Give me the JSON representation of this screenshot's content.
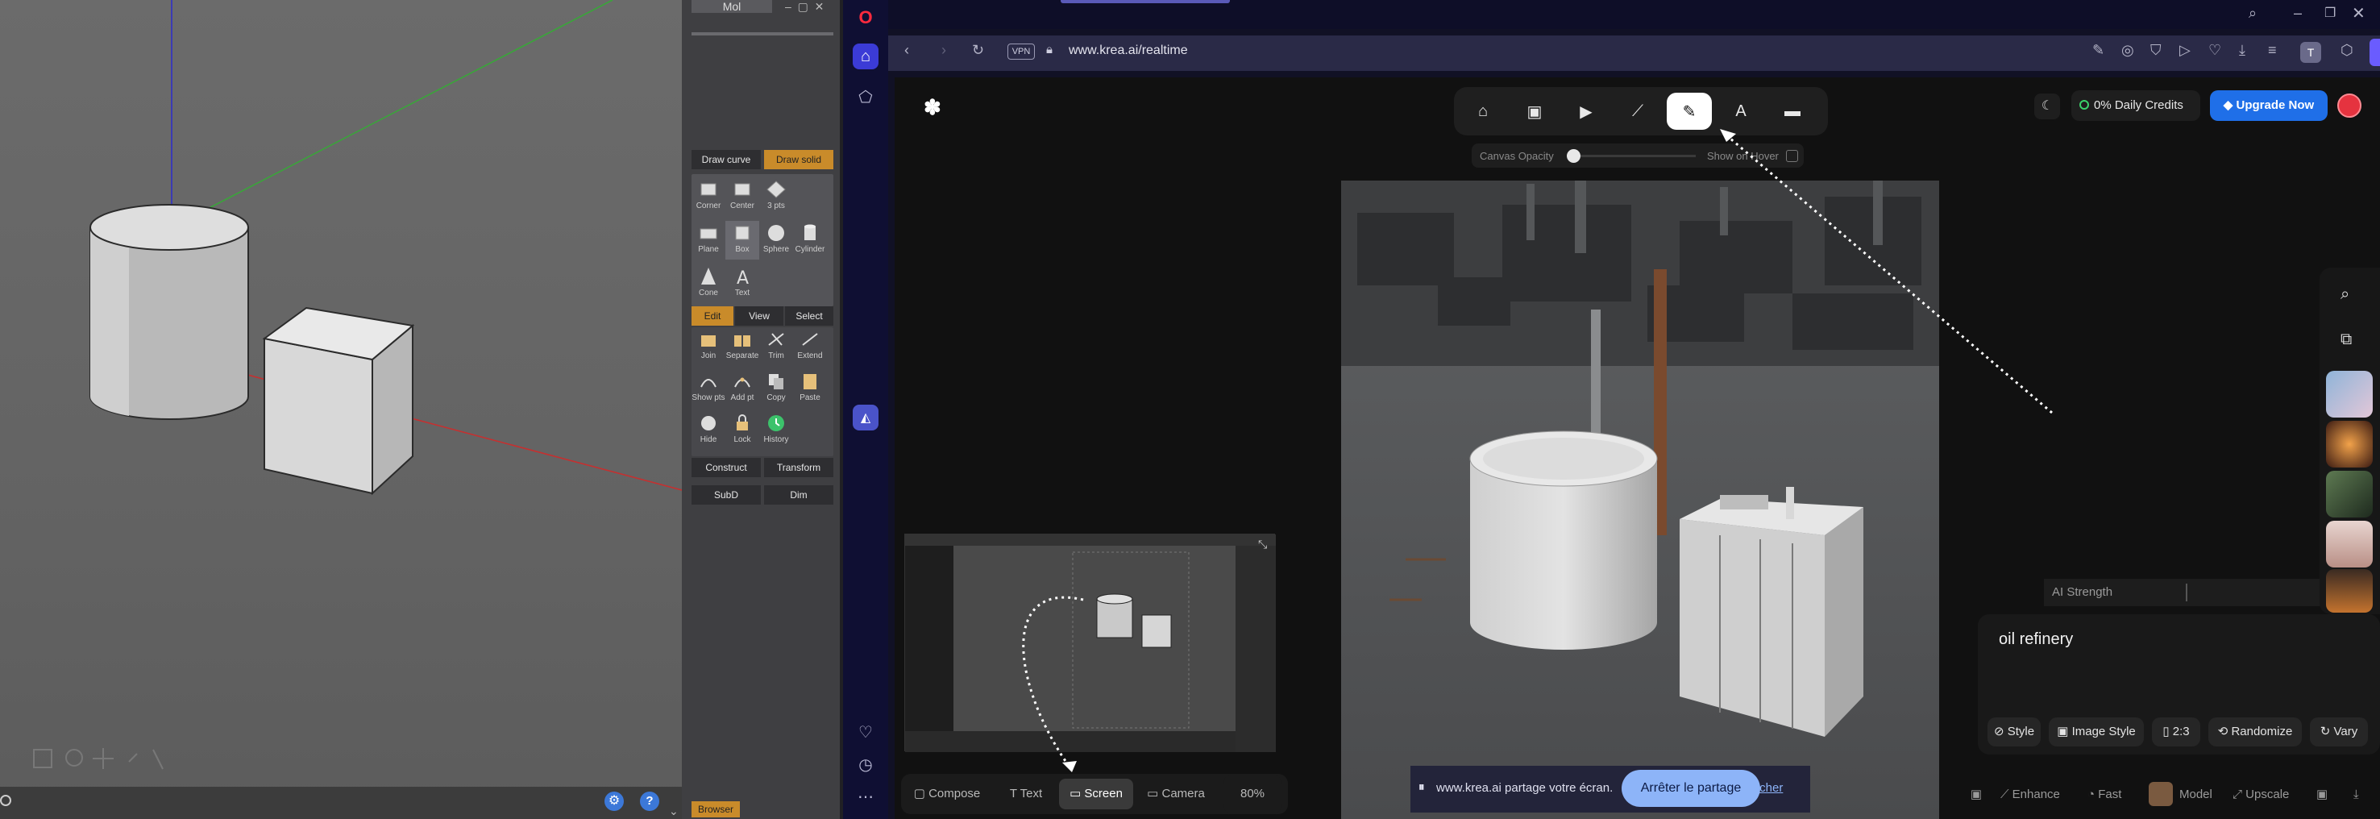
{
  "viewport3d": {
    "tab_label": "Mol",
    "panel": {
      "curve_tab": "Draw curve",
      "solid_tab": "Draw solid",
      "row1": [
        "Corner",
        "Center",
        "3 pts"
      ],
      "row2": [
        "Plane",
        "Box",
        "Sphere",
        "Cylinder"
      ],
      "row3": [
        "Cone",
        "Text"
      ],
      "edit_tabs": [
        "Edit",
        "View",
        "Select"
      ],
      "edit_row1": [
        "Join",
        "Separate",
        "Trim",
        "Extend"
      ],
      "edit_row2": [
        "Show pts",
        "Add pt",
        "Copy",
        "Paste"
      ],
      "edit_row3": [
        "Hide",
        "Lock",
        "History"
      ],
      "construct": "Construct",
      "transform": "Transform",
      "subd": "SubD",
      "dim": "Dim",
      "browser_tab": "Browser"
    }
  },
  "browser": {
    "url": "www.krea.ai/realtime",
    "vpn": "VPN"
  },
  "krea": {
    "canvas_opacity_label": "Canvas Opacity",
    "canvas_opacity_value": 0.0,
    "show_on_hover_label": "Show on Hover",
    "credits": "0% Daily Credits",
    "upgrade": "Upgrade Now",
    "ai_strength_label": "AI Strength",
    "prompt": "oil refinery",
    "pills": [
      "Style",
      "Image Style",
      "2:3",
      "Randomize",
      "Vary"
    ],
    "bottom_tools": [
      "Enhance",
      "Fast",
      "Model",
      "Upscale"
    ],
    "input_modes": [
      "Compose",
      "Text",
      "Screen",
      "Camera"
    ],
    "active_mode": "Screen",
    "zoom": "80%",
    "share_text": "www.krea.ai partage votre écran.",
    "stop_share": "Arrêter le partage",
    "hide": "Cacher",
    "colors": {
      "accent": "#1f6fe8",
      "active_tool": "#ffffff",
      "share_btn": "#8db4f8"
    }
  }
}
